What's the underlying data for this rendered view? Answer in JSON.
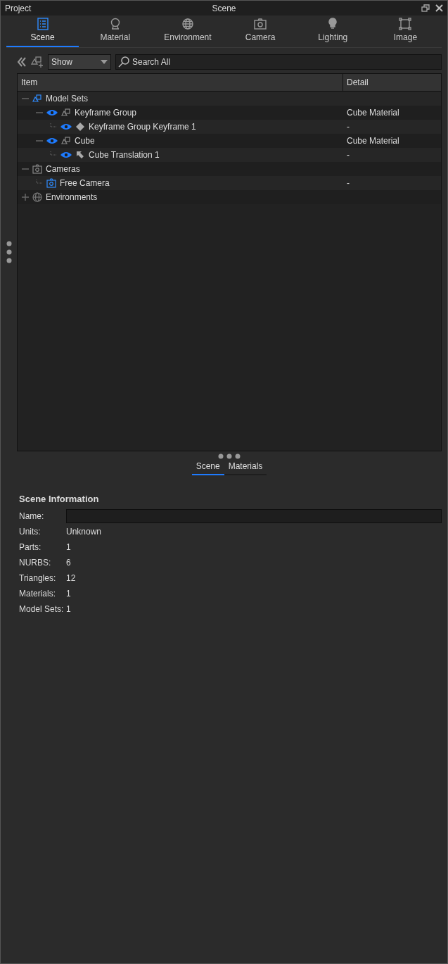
{
  "window": {
    "title_left": "Project",
    "title": "Scene"
  },
  "tabs": [
    {
      "label": "Scene",
      "selected": true
    },
    {
      "label": "Material",
      "selected": false
    },
    {
      "label": "Environment",
      "selected": false
    },
    {
      "label": "Camera",
      "selected": false
    },
    {
      "label": "Lighting",
      "selected": false
    },
    {
      "label": "Image",
      "selected": false
    }
  ],
  "toolbar": {
    "filter": "Show",
    "search": {
      "placeholder": "Search All"
    }
  },
  "tree": {
    "columns": [
      "Item",
      "Detail"
    ],
    "items": [
      {
        "label": "Model Sets",
        "kind": "modelsets",
        "expanded": true,
        "children": [
          {
            "label": "Keyframe Group",
            "kind": "group",
            "visible": true,
            "detail": "Cube Material",
            "expanded": true,
            "children": [
              {
                "label": "Keyframe Group Keyframe 1",
                "kind": "keyframe",
                "visible": true,
                "detail": "-"
              }
            ]
          },
          {
            "label": "Cube",
            "kind": "group",
            "visible": true,
            "detail": "Cube Material",
            "expanded": true,
            "children": [
              {
                "label": "Cube Translation 1",
                "kind": "translation",
                "visible": true,
                "detail": "-"
              }
            ]
          }
        ]
      },
      {
        "label": "Cameras",
        "kind": "cameras",
        "expanded": true,
        "children": [
          {
            "label": "Free Camera",
            "kind": "camera",
            "detail": "-"
          }
        ]
      },
      {
        "label": "Environments",
        "kind": "environments",
        "expanded": false
      }
    ]
  },
  "subtabs": [
    {
      "label": "Scene",
      "selected": true
    },
    {
      "label": "Materials",
      "selected": false
    }
  ],
  "info": {
    "title": "Scene Information",
    "name_label": "Name:",
    "fields": [
      {
        "label": "Units:",
        "value": "Unknown"
      },
      {
        "label": "Parts:",
        "value": "1"
      },
      {
        "label": "NURBS:",
        "value": "6"
      },
      {
        "label": "Triangles:",
        "value": "12"
      },
      {
        "label": "Materials:",
        "value": "1"
      },
      {
        "label": "Model Sets:",
        "value": "1"
      }
    ]
  }
}
